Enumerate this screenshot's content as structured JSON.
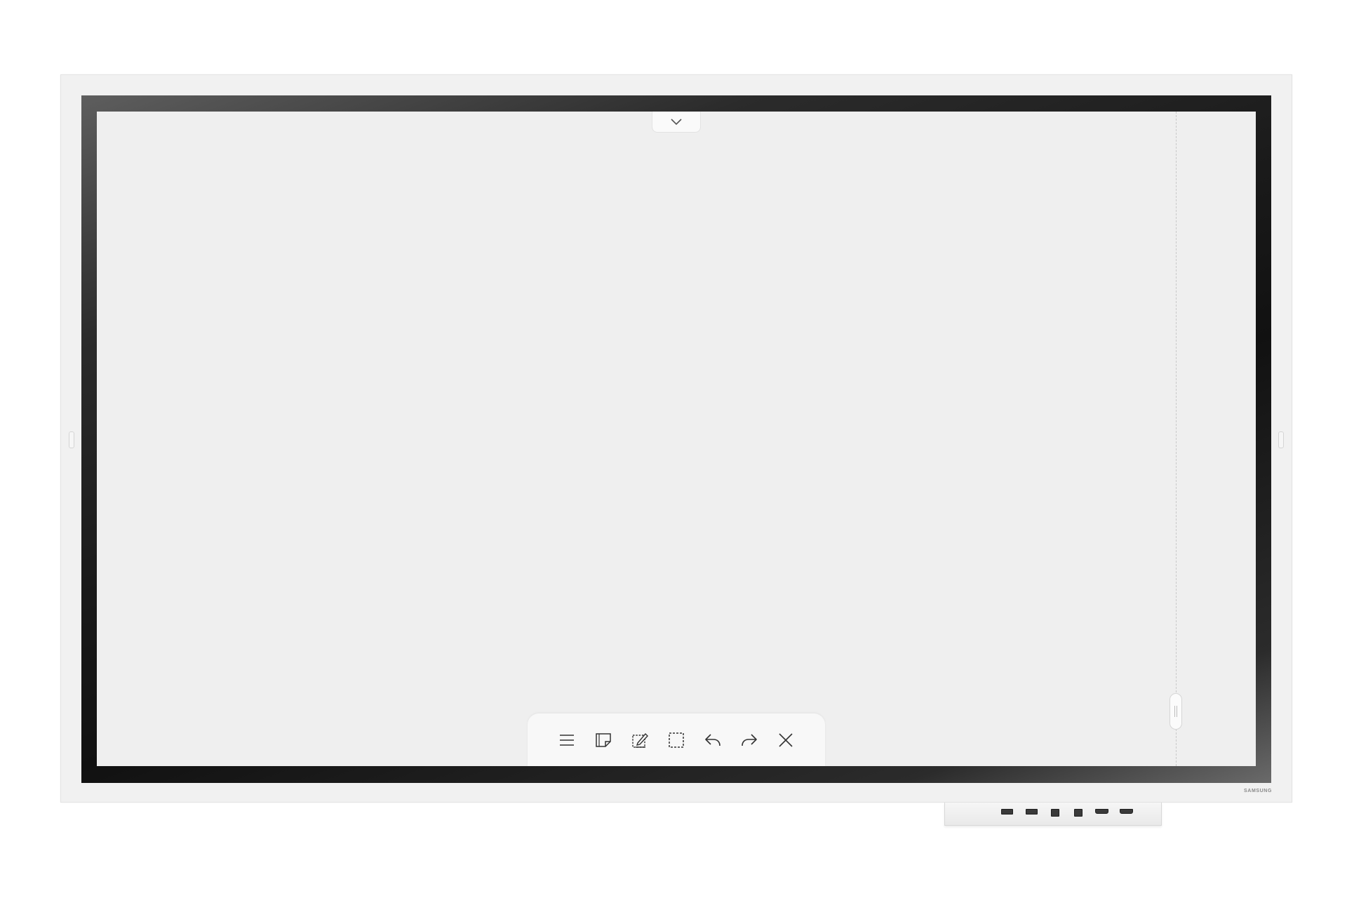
{
  "device": {
    "brand": "SAMSUNG"
  },
  "toolbar": {
    "items": [
      {
        "name": "menu",
        "icon": "hamburger-menu-icon"
      },
      {
        "name": "sticky-note",
        "icon": "sticky-note-icon"
      },
      {
        "name": "screen-capture",
        "icon": "capture-edit-icon"
      },
      {
        "name": "select",
        "icon": "dashed-select-icon"
      },
      {
        "name": "undo",
        "icon": "undo-icon"
      },
      {
        "name": "redo",
        "icon": "redo-icon"
      },
      {
        "name": "close",
        "icon": "close-icon"
      }
    ]
  },
  "top_tab": {
    "icon": "chevron-down-icon"
  },
  "scroll_handle": {
    "icon": "drag-handle-icon"
  },
  "dock": {
    "ports": [
      "usb-port",
      "usb-port",
      "usb-b-port",
      "usb-b-port",
      "hdmi-port",
      "hdmi-port"
    ]
  },
  "colors": {
    "canvas": "#efefef",
    "frame": "#f1f1f1",
    "bezel": "#111111",
    "icon": "#333333"
  }
}
